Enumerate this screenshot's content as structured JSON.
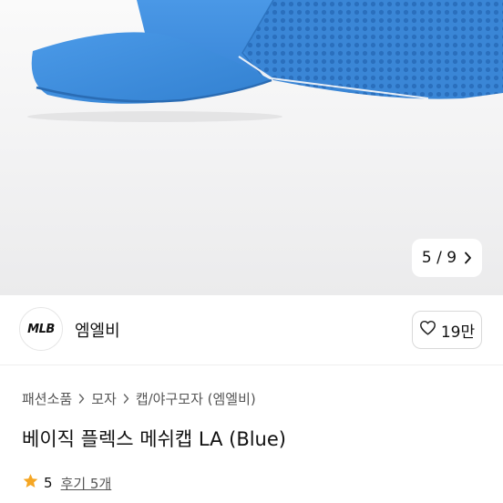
{
  "gallery": {
    "current": "5",
    "separator": "/",
    "total": "9",
    "image_alt": "Blue mesh baseball cap",
    "cap_color": "#3f8fe0"
  },
  "seller": {
    "logo_text": "MLB",
    "name": "엠엘비",
    "likes": "19만"
  },
  "breadcrumb": [
    "패션소품",
    "모자",
    "캡/야구모자 (엠엘비)"
  ],
  "product": {
    "title": "베이직 플렉스 메쉬캡 LA (Blue)"
  },
  "rating": {
    "score": "5",
    "reviews": "후기 5개",
    "star_color": "#f5a623"
  }
}
